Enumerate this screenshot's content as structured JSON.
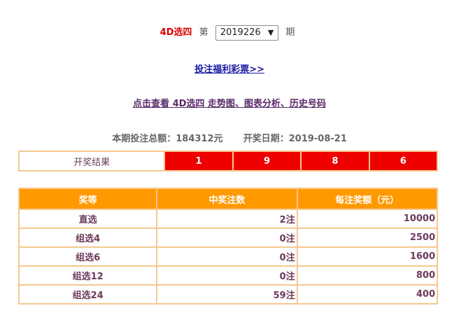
{
  "header": {
    "game_name": "4D选四",
    "di": "第",
    "period": "2019226",
    "qi": "期"
  },
  "links": {
    "buy": "投注福利彩票>>",
    "trend": "点击查看 4D选四 走势图、图表分析、历史号码"
  },
  "summary": {
    "total_label": "本期投注总额：",
    "total_value": "184312元",
    "date_label": "开奖日期：",
    "date_value": "2019-08-21"
  },
  "result": {
    "label": "开奖结果",
    "numbers": [
      "1",
      "9",
      "8",
      "6"
    ]
  },
  "colors": {
    "ball": "#ee0000",
    "header_bg": "#ff9900",
    "border": "#f6c890",
    "game_name": "#dd0000"
  },
  "prize_table": {
    "headers": [
      "奖等",
      "中奖注数",
      "每注奖额（元）"
    ],
    "rows": [
      {
        "level": "直选",
        "count": "2注",
        "amount": "10000"
      },
      {
        "level": "组选4",
        "count": "0注",
        "amount": "2500"
      },
      {
        "level": "组选6",
        "count": "0注",
        "amount": "1600"
      },
      {
        "level": "组选12",
        "count": "0注",
        "amount": "800"
      },
      {
        "level": "组选24",
        "count": "59注",
        "amount": "400"
      }
    ]
  }
}
